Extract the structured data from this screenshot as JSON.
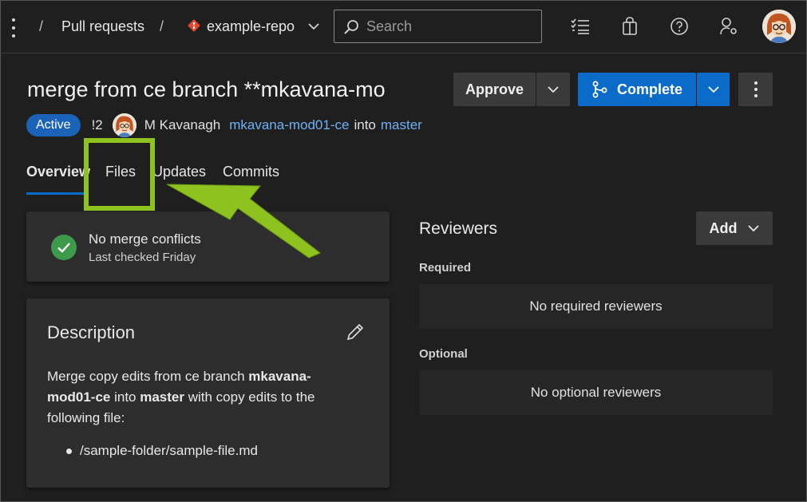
{
  "topbar": {
    "crumb_pull_requests": "Pull requests",
    "separator": "/",
    "repo_name": "example-repo",
    "search_placeholder": "Search"
  },
  "pr": {
    "title": "merge from ce branch **mkavana-mo",
    "status": "Active",
    "number": "!2",
    "author": "M Kavanagh",
    "source_branch": "mkavana-mod01-ce",
    "into_text": "into",
    "target_branch": "master"
  },
  "actions": {
    "approve_label": "Approve",
    "complete_label": "Complete",
    "accent": "#0a6bc8"
  },
  "tabs": [
    {
      "label": "Overview"
    },
    {
      "label": "Files"
    },
    {
      "label": "Updates"
    },
    {
      "label": "Commits"
    }
  ],
  "merge_status": {
    "title": "No merge conflicts",
    "subtitle": "Last checked Friday"
  },
  "description": {
    "heading": "Description",
    "text_1": "Merge copy edits from ce branch ",
    "text_bold_1": "mkavana-mod01-ce",
    "text_2": " into ",
    "text_bold_2": "master",
    "text_3": " with copy edits to the following file:",
    "files": [
      "/sample-folder/sample-file.md"
    ]
  },
  "reviewers": {
    "heading": "Reviewers",
    "add_label": "Add",
    "required_label": "Required",
    "required_empty": "No required reviewers",
    "optional_label": "Optional",
    "optional_empty": "No optional reviewers"
  },
  "annotation": {
    "highlight_color": "#8dc21f"
  }
}
